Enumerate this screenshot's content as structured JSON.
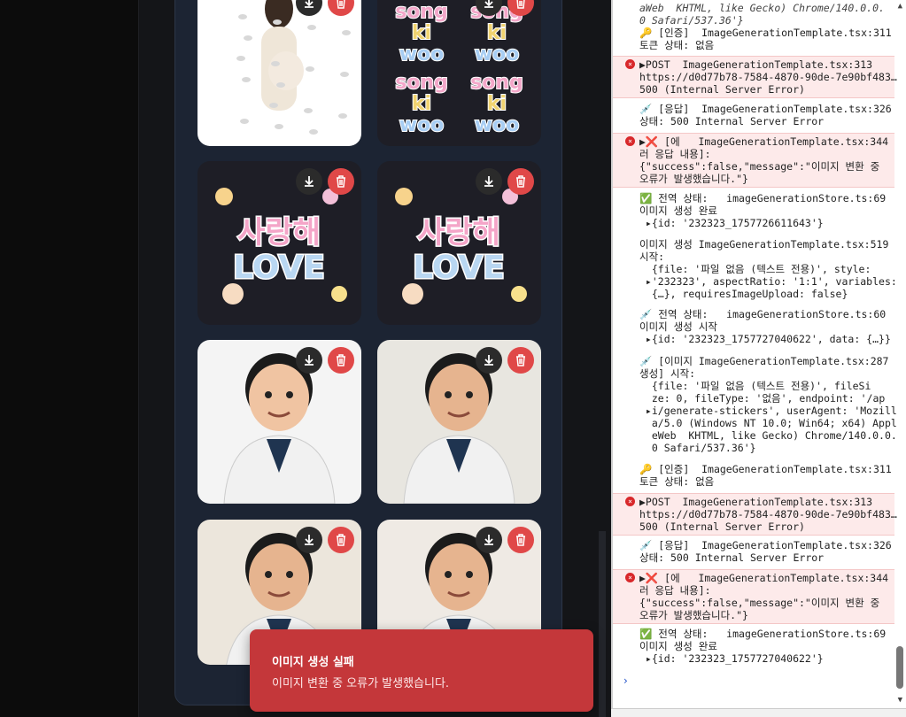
{
  "toast": {
    "title": "이미지 생성 실패",
    "message": "이미지 변환 중 오류가 발생했습니다."
  },
  "gallery": {
    "cards": [
      {
        "name": "pregnant-woman-sticker",
        "bg": "#ffffff"
      },
      {
        "name": "songkiwoo-text-sticker",
        "bg": "#1e1e26",
        "text": "song ki woo"
      },
      {
        "name": "love-sticker-1",
        "bg": "#1e1e26",
        "text": "사랑해 LOVE"
      },
      {
        "name": "love-sticker-2",
        "bg": "#1e1e26",
        "text": "사랑해 LOVE"
      },
      {
        "name": "doctor-woman-sticker",
        "bg": "#f4f4f4"
      },
      {
        "name": "doctor-man-sticker-1",
        "bg": "#e8e6e0"
      },
      {
        "name": "doctor-man-sticker-2",
        "bg": "#ece6dc"
      },
      {
        "name": "doctor-man-sticker-3",
        "bg": "#efeae4"
      }
    ]
  },
  "console": {
    "lines": [
      {
        "t": "aWeb  KHTML, like Gecko) Chrome/140.0.0.\n0 Safari/537.36'}",
        "cls": "ital"
      },
      {
        "t": "🔑 [인증]  ImageGenerationTemplate.tsx:311\n토큰 상태: 없음"
      },
      {
        "t": "▶POST  ImageGenerationTemplate.tsx:313 \nhttps://d0d77b78-7584-4870-90de-7e90bf483…\n500 (Internal Server Error)",
        "err": true
      },
      {
        "t": "💉 [응답]  ImageGenerationTemplate.tsx:326\n상태: 500 Internal Server Error"
      },
      {
        "t": "▶❌ [에   ImageGenerationTemplate.tsx:344\n러 응답 내용]:\n{\"success\":false,\"message\":\"이미지 변환 중\n오류가 발생했습니다.\"}",
        "err": true
      },
      {
        "t": "✅ 전역 상태:   imageGenerationStore.ts:69\n이미지 생성 완료\n ▸{id: '232323_1757726611643'}"
      },
      {
        "t": "이미지 생성 ImageGenerationTemplate.tsx:519\n시작:\n  {file: '파일 없음 (텍스트 전용)', style:\n ▸'232323', aspectRatio: '1:1', variables:\n  {…}, requiresImageUpload: false}"
      },
      {
        "t": "💉 전역 상태:   imageGenerationStore.ts:60\n이미지 생성 시작\n ▸{id: '232323_1757727040622', data: {…}}"
      },
      {
        "t": "💉 [이미지 ImageGenerationTemplate.tsx:287\n생성] 시작:\n  {file: '파일 없음 (텍스트 전용)', fileSi\n  ze: 0, fileType: '없음', endpoint: '/ap\n ▸i/generate-stickers', userAgent: 'Mozill\n  a/5.0 (Windows NT 10.0; Win64; x64) Appl\n  eWeb  KHTML, like Gecko) Chrome/140.0.0.\n  0 Safari/537.36'}"
      },
      {
        "t": "🔑 [인증]  ImageGenerationTemplate.tsx:311\n토큰 상태: 없음"
      },
      {
        "t": "▶POST  ImageGenerationTemplate.tsx:313 \nhttps://d0d77b78-7584-4870-90de-7e90bf483…\n500 (Internal Server Error)",
        "err": true
      },
      {
        "t": "💉 [응답]  ImageGenerationTemplate.tsx:326\n상태: 500 Internal Server Error"
      },
      {
        "t": "▶❌ [에   ImageGenerationTemplate.tsx:344\n러 응답 내용]:\n{\"success\":false,\"message\":\"이미지 변환 중\n오류가 발생했습니다.\"}",
        "err": true
      },
      {
        "t": "✅ 전역 상태:   imageGenerationStore.ts:69\n이미지 생성 완료\n ▸{id: '232323_1757727040622'}"
      }
    ],
    "prompt": "›"
  }
}
